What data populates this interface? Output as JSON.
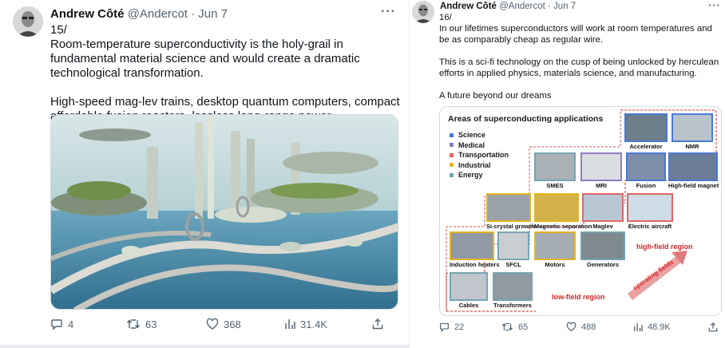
{
  "tweets": [
    {
      "author": {
        "name": "Andrew Côté",
        "handle": "@Andercot",
        "date": "· Jun 7"
      },
      "more": "···",
      "text": "15/\nRoom-temperature superconductivity is the holy-grail in fundamental material science and would create a dramatic technological transformation.\n\nHigh-speed mag-lev trains, desktop quantum computers, compact affordable fusion reactors, lossless long-range power transmission.",
      "stats": {
        "replies": "4",
        "retweets": "63",
        "likes": "368",
        "views": "31.4K"
      }
    },
    {
      "author": {
        "name": "Andrew Côté",
        "handle": "@Andercot",
        "date": "· Jun 7"
      },
      "more": "···",
      "text": "16/\nIn our lifetimes superconductors will work at room temperatures and be as comparably cheap as regular wire.\n\nThis is a sci-fi technology on the cusp of being unlocked by herculean efforts in applied physics, materials science, and manufacturing.\n\nA future beyond our dreams",
      "stats": {
        "replies": "22",
        "retweets": "65",
        "likes": "488",
        "views": "48.9K"
      }
    }
  ],
  "diagram": {
    "title": "Areas of superconducting applications",
    "legend": [
      {
        "label": "Science",
        "color": "#4a78d6"
      },
      {
        "label": "Medical",
        "color": "#8e7cc3"
      },
      {
        "label": "Transportation",
        "color": "#e06666"
      },
      {
        "label": "Industrial",
        "color": "#e6b422"
      },
      {
        "label": "Energy",
        "color": "#76a5af"
      }
    ],
    "tiles": {
      "accelerator": "Accelerator",
      "nmr": "NMR",
      "smes": "SMES",
      "mri": "MRI",
      "fusion": "Fusion",
      "hfm": "High-field magnet",
      "si": "Si-crystal growth",
      "magsep": "Magnetic separation",
      "maglev": "Maglev",
      "eair": "Electric aircraft",
      "heaters": "Induction heaters",
      "sfcl": "SFCL",
      "motors": "Motors",
      "generators": "Generators",
      "cables": "Cables",
      "transformers": "Transformers"
    },
    "high_field": "high-field region",
    "low_field": "low-field region",
    "operating": "operating fields"
  }
}
